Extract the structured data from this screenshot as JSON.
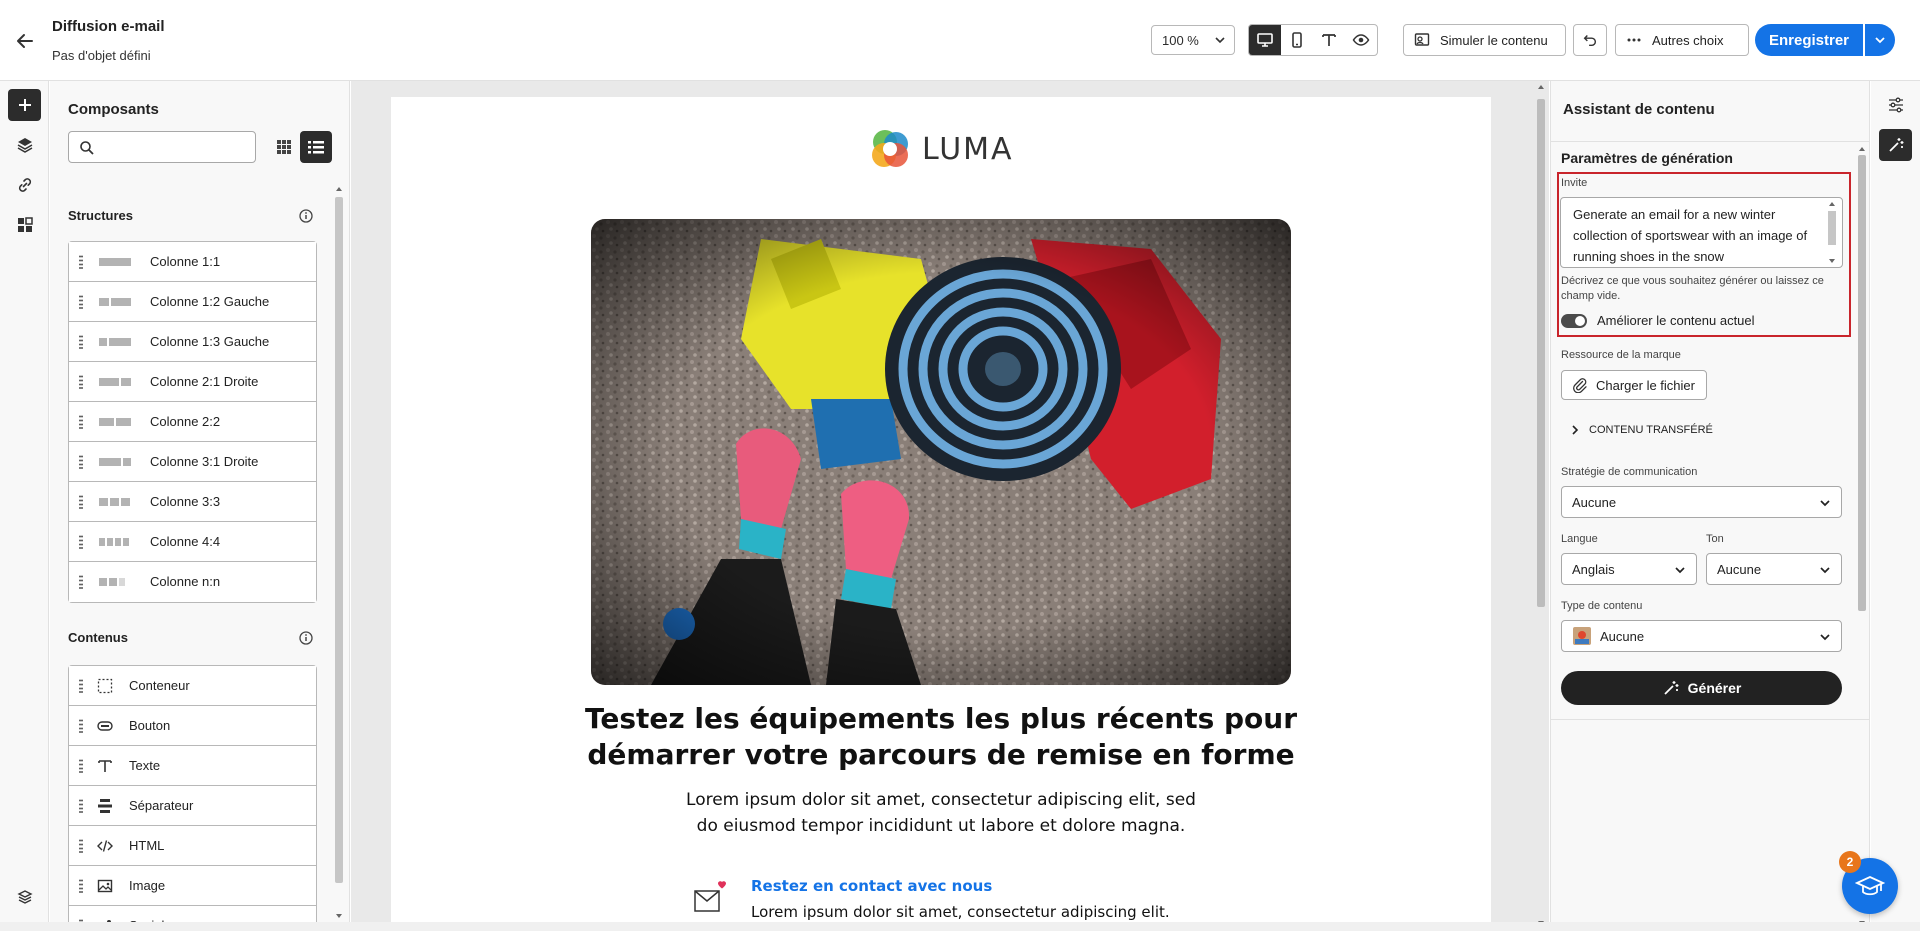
{
  "header": {
    "title": "Diffusion e-mail",
    "subtitle": "Pas d'objet défini",
    "zoom": "100 %",
    "simulate_label": "Simuler le contenu",
    "more_label": "Autres choix",
    "save_label": "Enregistrer"
  },
  "components": {
    "title": "Composants",
    "search_placeholder": "",
    "structures_title": "Structures",
    "structures": [
      {
        "label": "Colonne 1:1"
      },
      {
        "label": "Colonne 1:2 Gauche"
      },
      {
        "label": "Colonne 1:3 Gauche"
      },
      {
        "label": "Colonne 2:1 Droite"
      },
      {
        "label": "Colonne 2:2"
      },
      {
        "label": "Colonne 3:1 Droite"
      },
      {
        "label": "Colonne 3:3"
      },
      {
        "label": "Colonne 4:4"
      },
      {
        "label": "Colonne n:n"
      }
    ],
    "contents_title": "Contenus",
    "contents": [
      {
        "label": "Conteneur",
        "icon": "container-icon"
      },
      {
        "label": "Bouton",
        "icon": "button-icon"
      },
      {
        "label": "Texte",
        "icon": "text-icon"
      },
      {
        "label": "Séparateur",
        "icon": "divider-icon"
      },
      {
        "label": "HTML",
        "icon": "code-icon"
      },
      {
        "label": "Image",
        "icon": "image-icon"
      },
      {
        "label": "Social",
        "icon": "social-icon"
      }
    ]
  },
  "email": {
    "logo_text": "LUMA",
    "headline_line1": "Testez les équipements les plus récents pour",
    "headline_line2": "démarrer votre parcours de remise en forme",
    "body_line1": "Lorem ipsum dolor sit amet, consectetur adipiscing elit, sed",
    "body_line2": "do eiusmod tempor incididunt ut labore et dolore magna.",
    "contact_title": "Restez en contact avec nous",
    "contact_text": "Lorem ipsum dolor sit amet, consectetur adipiscing elit."
  },
  "assistant": {
    "title": "Assistant de contenu",
    "params_title": "Paramètres de génération",
    "prompt_label": "Invite",
    "prompt_value": "Generate an email for a new winter collection of sportswear with an image of running shoes in the snow",
    "prompt_hint": "Décrivez ce que vous souhaitez générer ou laissez ce champ vide.",
    "improve_label": "Améliorer le contenu actuel",
    "brand_label": "Ressource de la marque",
    "upload_label": "Charger le fichier",
    "transferred_label": "CONTENU TRANSFÉRÉ",
    "strategy_label": "Stratégie de communication",
    "strategy_value": "Aucune",
    "language_label": "Langue",
    "language_value": "Anglais",
    "tone_label": "Ton",
    "tone_value": "Aucune",
    "content_type_label": "Type de contenu",
    "content_type_value": "Aucune",
    "generate_label": "Générer"
  },
  "help": {
    "badge": "2"
  },
  "colors": {
    "accent": "#1473e6",
    "highlight": "#c9252c"
  }
}
